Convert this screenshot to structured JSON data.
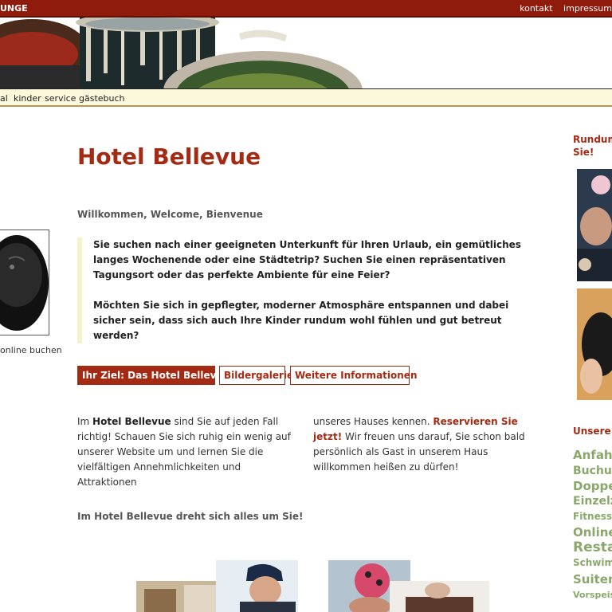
{
  "topbar": {
    "brand": "UNGE",
    "links": [
      "kontakt",
      "impressum"
    ]
  },
  "nav": {
    "items": [
      "al",
      "kinder",
      "service",
      "gästebuch"
    ]
  },
  "left": {
    "caption": "online buchen"
  },
  "main": {
    "title": "Hotel Bellevue",
    "welcome": "Willkommen, Welcome, Bienvenue",
    "quote_p1": "Sie suchen nach einer geeigneten Unterkunft für Ihren Urlaub, ein gemütliches langes Wochenende oder eine Städtetrip? Suchen Sie einen repräsentativen Tagungsort oder das perfekte Ambiente für eine Feier?",
    "quote_p2": "Möchten Sie sich in gepflegter, moderner Atmosphäre entspannen und dabei sicher sein, dass sich auch Ihre Kinder rundum wohl fühlen und gut betreut werden?",
    "tabs": [
      "Ihr Ziel: Das Hotel Bellevue",
      "Bildergalerie",
      "Weitere Informationen"
    ],
    "col1": {
      "pre": "Im ",
      "bold": "Hotel Bellevue",
      "post": " sind Sie auf jeden Fall richtig! Schauen Sie sich ruhig ein wenig auf unserer Website um und lernen Sie die vielfältigen Annehmlichkeiten und Attraktionen"
    },
    "col2": {
      "pre": "unseres Hauses kennen. ",
      "link": "Reservieren Sie jetzt!",
      "post": " Wir freuen uns darauf, Sie schon bald persönlich als Gast in unserem Haus willkommen heißen zu dürfen!"
    },
    "tagline": "Im Hotel Bellevue dreht sich alles um Sie!"
  },
  "sidebar": {
    "title_line1": "Rundum",
    "title_line2": "Sie!",
    "subtitle": "Unsere",
    "links": [
      "Anfahrt",
      "Buchung",
      "Doppel",
      "Einzelzi",
      "Fitness u",
      "Online",
      "Restau",
      "Schwim",
      "Suiten",
      "Vorspeis"
    ]
  },
  "colors": {
    "brand_red": "#a32b14",
    "topbar": "#8f1b0c",
    "nav_bg": "#fbf8dc",
    "sidebar_link": "#8aa86b"
  }
}
